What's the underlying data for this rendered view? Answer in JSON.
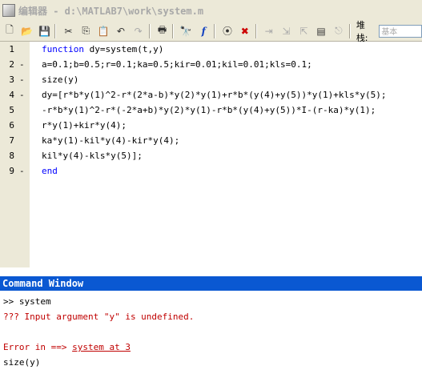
{
  "titlebar": {
    "title": "编辑器 - d:\\MATLAB7\\work\\system.m"
  },
  "toolbar": {
    "buttons": [
      {
        "name": "new-file",
        "glyph": "🗋"
      },
      {
        "name": "open",
        "glyph": "📂"
      },
      {
        "name": "save",
        "glyph": "💾"
      },
      {
        "name": "cut",
        "glyph": "✂"
      },
      {
        "name": "copy",
        "glyph": "⎘"
      },
      {
        "name": "paste",
        "glyph": "📋"
      },
      {
        "name": "undo",
        "glyph": "↶"
      },
      {
        "name": "redo",
        "glyph": "↷"
      },
      {
        "name": "print",
        "glyph": "🖶"
      },
      {
        "name": "find",
        "glyph": "🔭"
      },
      {
        "name": "function",
        "glyph": "f"
      }
    ],
    "stack_label": "堆栈:",
    "stack_value": "基本"
  },
  "editor": {
    "lines": [
      {
        "num": "1",
        "mark": "",
        "code": "function dy=system(t,y)"
      },
      {
        "num": "2",
        "mark": "-",
        "code": "a=0.1;b=0.5;r=0.1;ka=0.5;kir=0.01;kil=0.01;kls=0.1;"
      },
      {
        "num": "3",
        "mark": "-",
        "code": "size(y)"
      },
      {
        "num": "4",
        "mark": "-",
        "code": "dy=[r*b*y(1)^2-r*(2*a-b)*y(2)*y(1)+r*b*(y(4)+y(5))*y(1)+kls*y(5);"
      },
      {
        "num": "5",
        "mark": "",
        "code": "-r*b*y(1)^2-r*(-2*a+b)*y(2)*y(1)-r*b*(y(4)+y(5))*I-(r-ka)*y(1);"
      },
      {
        "num": "6",
        "mark": "",
        "code": "r*y(1)+kir*y(4);"
      },
      {
        "num": "7",
        "mark": "",
        "code": "ka*y(1)-kil*y(4)-kir*y(4);"
      },
      {
        "num": "8",
        "mark": "",
        "code": "kil*y(4)-kls*y(5)];"
      },
      {
        "num": "9",
        "mark": "-",
        "code": "end"
      }
    ]
  },
  "command_window": {
    "title": "Command Window",
    "prompt_line": ">> system",
    "error_line": "??? Input argument \"y\" is undefined.",
    "error_in_prefix": "Error in ==> ",
    "error_link": "system at 3",
    "source_line": "size(y)"
  }
}
